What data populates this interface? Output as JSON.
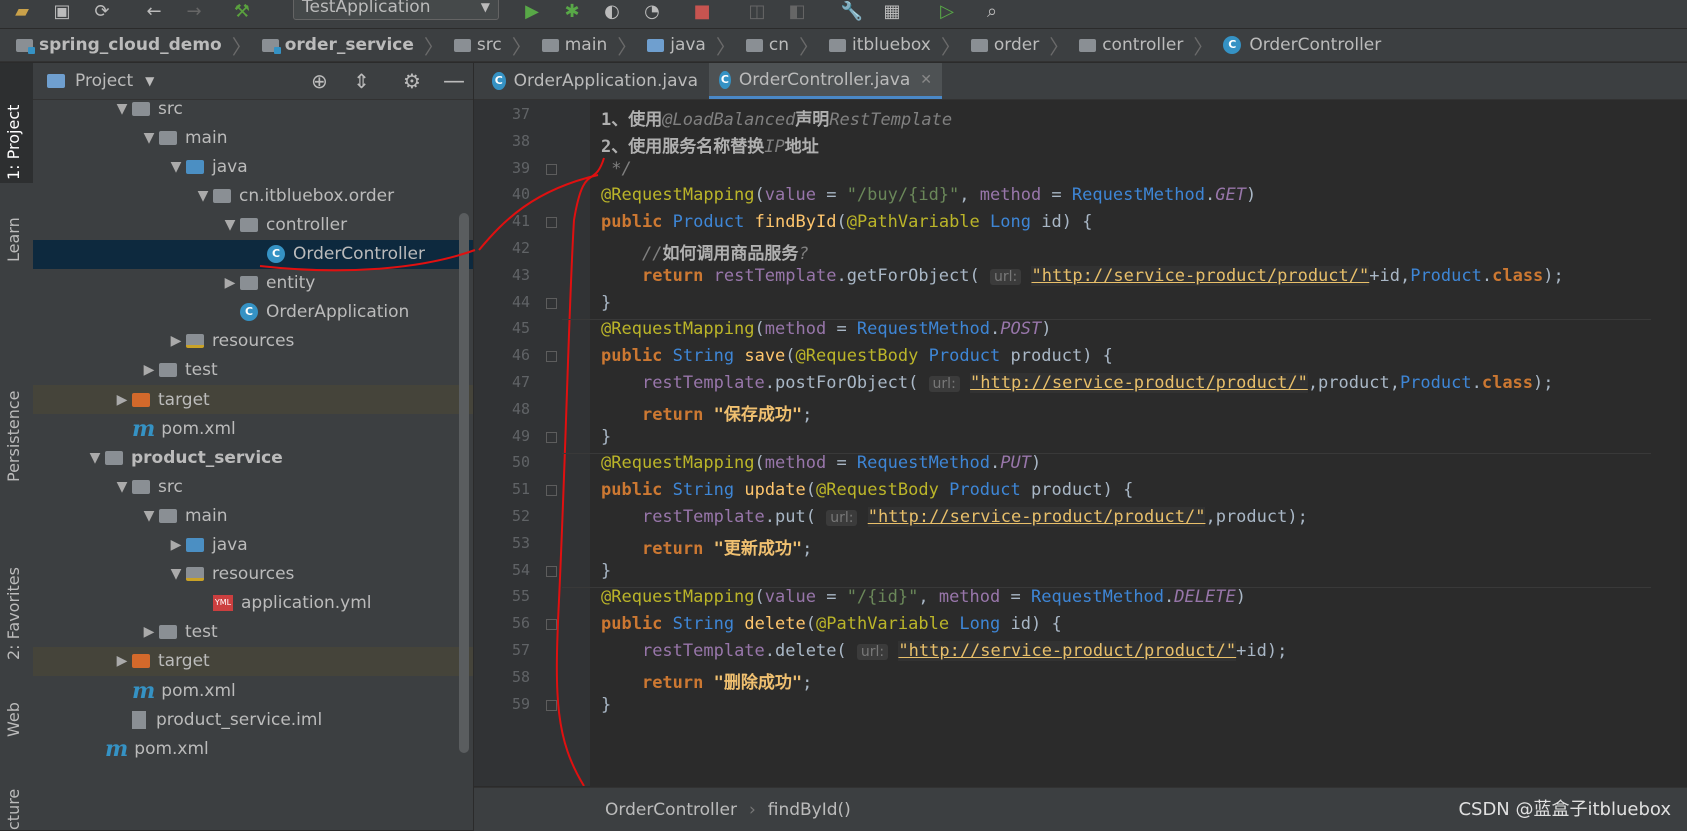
{
  "toolbar": {
    "run_config_label": "TestApplication",
    "icons": [
      "open-folder-icon",
      "save-icon",
      "sync-icon",
      "back-icon",
      "forward-icon",
      "build-icon",
      "run-icon",
      "debug-icon",
      "coverage-icon",
      "profile-icon",
      "stop-icon",
      "attach-icon",
      "settings-wrench-icon",
      "project-structure-icon",
      "sdk-icon",
      "search-icon"
    ]
  },
  "breadcrumb": {
    "items": [
      "spring_cloud_demo",
      "order_service",
      "src",
      "main",
      "java",
      "cn",
      "itbluebox",
      "order",
      "controller",
      "OrderController"
    ]
  },
  "sidebar_tabs": {
    "project": "1: Project",
    "learn": "Learn",
    "persistence": "Persistence",
    "favorites": "2: Favorites",
    "web": "Web",
    "structure": "cture"
  },
  "project_panel": {
    "title": "Project",
    "tree": [
      {
        "label": "src",
        "depth": 3,
        "arrow": "down",
        "icon": "folder"
      },
      {
        "label": "main",
        "depth": 4,
        "arrow": "down",
        "icon": "folder"
      },
      {
        "label": "java",
        "depth": 5,
        "arrow": "down",
        "icon": "folder-blue"
      },
      {
        "label": "cn.itbluebox.order",
        "depth": 6,
        "arrow": "down",
        "icon": "package"
      },
      {
        "label": "controller",
        "depth": 7,
        "arrow": "down",
        "icon": "package"
      },
      {
        "label": "OrderController",
        "depth": 8,
        "arrow": "",
        "icon": "class",
        "selected": true
      },
      {
        "label": "entity",
        "depth": 7,
        "arrow": "right",
        "icon": "package"
      },
      {
        "label": "OrderApplication",
        "depth": 7,
        "arrow": "",
        "icon": "app-class"
      },
      {
        "label": "resources",
        "depth": 5,
        "arrow": "right",
        "icon": "resources"
      },
      {
        "label": "test",
        "depth": 4,
        "arrow": "right",
        "icon": "folder"
      },
      {
        "label": "target",
        "depth": 3,
        "arrow": "right",
        "icon": "folder-orange",
        "excluded": true
      },
      {
        "label": "pom.xml",
        "depth": 3,
        "arrow": "",
        "icon": "maven"
      },
      {
        "label": "product_service",
        "depth": 2,
        "arrow": "down",
        "icon": "module",
        "bold": true
      },
      {
        "label": "src",
        "depth": 3,
        "arrow": "down",
        "icon": "folder"
      },
      {
        "label": "main",
        "depth": 4,
        "arrow": "down",
        "icon": "folder"
      },
      {
        "label": "java",
        "depth": 5,
        "arrow": "right",
        "icon": "folder-blue"
      },
      {
        "label": "resources",
        "depth": 5,
        "arrow": "down",
        "icon": "resources"
      },
      {
        "label": "application.yml",
        "depth": 6,
        "arrow": "",
        "icon": "yml"
      },
      {
        "label": "test",
        "depth": 4,
        "arrow": "right",
        "icon": "folder"
      },
      {
        "label": "target",
        "depth": 3,
        "arrow": "right",
        "icon": "folder-orange",
        "excluded": true
      },
      {
        "label": "pom.xml",
        "depth": 3,
        "arrow": "",
        "icon": "maven"
      },
      {
        "label": "product_service.iml",
        "depth": 3,
        "arrow": "",
        "icon": "iml"
      },
      {
        "label": "pom.xml",
        "depth": 2,
        "arrow": "",
        "icon": "maven"
      }
    ]
  },
  "tabs": [
    {
      "label": "OrderApplication.java",
      "active": false
    },
    {
      "label": "OrderController.java",
      "active": true
    }
  ],
  "editor": {
    "lines": [
      {
        "n": "37",
        "html": "<span class='cmtb'>1、使用</span><span class='cmt'>@LoadBalanced</span><span class='cmtb'>声明</span><span class='cmt'>RestTemplate</span>"
      },
      {
        "n": "38",
        "html": "<span class='cmtb'>2、使用服务名称替换</span><span class='cmt'>IP</span><span class='cmtb'>地址</span>"
      },
      {
        "n": "39",
        "html": "<span class='cmt'> */</span>"
      },
      {
        "n": "40",
        "html": "<span class='ann'>@RequestMapping</span>(<span class='field'>value</span> = <span class='str'>\"/buy/{id}\"</span>, <span class='field'>method</span> = <span class='cls'>RequestMethod</span>.<span class='enumv'>GET</span>)"
      },
      {
        "n": "41",
        "html": "<span class='kw'>public</span> <span class='cls'>Product</span> <span class='fn'>findById</span>(<span class='ann'>@PathVariable</span> <span class='cls'>Long</span> <span class='param'>id</span>) {"
      },
      {
        "n": "42",
        "html": "    <span class='cmt'>//</span><span class='cmtb'>如何调用商品服务</span><span class='cmt'>?</span>"
      },
      {
        "n": "43",
        "html": "    <span class='kw'>return</span> <span class='field'>restTemplate</span>.getForObject( <span class='hint'>url:</span> <span class='strurl'>\"http://service-product/product/\"</span>+id,<span class='cls'>Product</span>.<span class='kw'>class</span>);"
      },
      {
        "n": "44",
        "html": "}"
      },
      {
        "n": "45",
        "html": "<span class='ann'>@RequestMapping</span>(<span class='field'>method</span> = <span class='cls'>RequestMethod</span>.<span class='enumv'>POST</span>)"
      },
      {
        "n": "46",
        "html": "<span class='kw'>public</span> <span class='cls'>String</span> <span class='fn'>save</span>(<span class='ann'>@RequestBody</span> <span class='cls'>Product</span> <span class='param'>product</span>) {"
      },
      {
        "n": "47",
        "html": "    <span class='field'>restTemplate</span>.postForObject( <span class='hint'>url:</span> <span class='strurl'>\"http://service-product/product/\"</span>,product,<span class='cls'>Product</span>.<span class='kw'>class</span>);"
      },
      {
        "n": "48",
        "html": "    <span class='kw'>return</span> <span class='boldstr'>\"保存成功\"</span>;"
      },
      {
        "n": "49",
        "html": "}"
      },
      {
        "n": "50",
        "html": "<span class='ann'>@RequestMapping</span>(<span class='field'>method</span> = <span class='cls'>RequestMethod</span>.<span class='enumv'>PUT</span>)"
      },
      {
        "n": "51",
        "html": "<span class='kw'>public</span> <span class='cls'>String</span> <span class='fn'>update</span>(<span class='ann'>@RequestBody</span> <span class='cls'>Product</span> <span class='param'>product</span>) {"
      },
      {
        "n": "52",
        "html": "    <span class='field'>restTemplate</span>.put( <span class='hint'>url:</span> <span class='strurl'>\"http://service-product/product/\"</span>,product);"
      },
      {
        "n": "53",
        "html": "    <span class='kw'>return</span> <span class='boldstr'>\"更新成功\"</span>;"
      },
      {
        "n": "54",
        "html": "}"
      },
      {
        "n": "55",
        "html": "<span class='ann'>@RequestMapping</span>(<span class='field'>value</span> = <span class='str'>\"/{id}\"</span>, <span class='field'>method</span> = <span class='cls'>RequestMethod</span>.<span class='enumv'>DELETE</span>)"
      },
      {
        "n": "56",
        "html": "<span class='kw'>public</span> <span class='cls'>String</span> <span class='fn'>delete</span>(<span class='ann'>@PathVariable</span> <span class='cls'>Long</span> <span class='param'>id</span>) {"
      },
      {
        "n": "57",
        "html": "    <span class='field'>restTemplate</span>.delete( <span class='hint'>url:</span> <span class='strurl'>\"http://service-product/product/\"</span>+id);"
      },
      {
        "n": "58",
        "html": "    <span class='kw'>return</span> <span class='boldstr'>\"删除成功\"</span>;"
      },
      {
        "n": "59",
        "html": "}"
      }
    ]
  },
  "status_bar": {
    "class_crumb": "OrderController",
    "method_crumb": "findById()"
  },
  "watermark": "CSDN @蓝盒子itbluebox",
  "colors": {
    "editor_bg": "#2b2b2b",
    "panel_bg": "#3c3f41",
    "selection": "#0d293e",
    "annotation_stroke": "#e01010"
  }
}
